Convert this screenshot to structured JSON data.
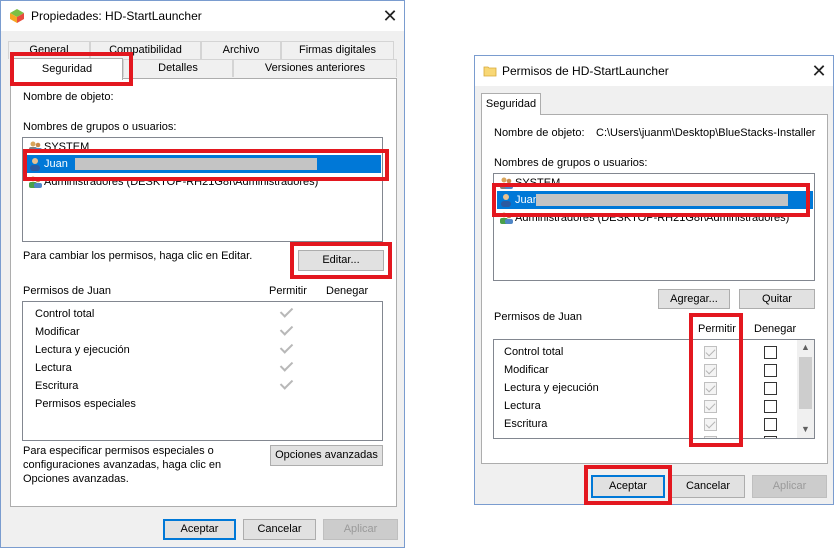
{
  "left_window": {
    "title": "Propiedades: HD-StartLauncher",
    "tabs_row1": [
      "General",
      "Compatibilidad",
      "Archivo",
      "Firmas digitales"
    ],
    "tabs_row2": [
      "Seguridad",
      "Detalles",
      "Versiones anteriores"
    ],
    "object_name_label": "Nombre de objeto:",
    "groups_label": "Nombres de grupos o usuarios:",
    "users": [
      "SYSTEM",
      "Juan",
      "Administradores (DESKTOP-RH21G8I\\Administradores)"
    ],
    "change_text": "Para cambiar los permisos, haga clic en Editar.",
    "edit_button": "Editar...",
    "perm_title": "Permisos de Juan",
    "allow_header": "Permitir",
    "deny_header": "Denegar",
    "permissions": [
      "Control total",
      "Modificar",
      "Lectura y ejecución",
      "Lectura",
      "Escritura",
      "Permisos especiales"
    ],
    "special_text_1": "Para especificar permisos especiales o",
    "special_text_2": "configuraciones avanzadas, haga clic en",
    "special_text_3": "Opciones avanzadas.",
    "advanced_button": "Opciones avanzadas",
    "ok_button": "Aceptar",
    "cancel_button": "Cancelar",
    "apply_button": "Aplicar"
  },
  "right_window": {
    "title": "Permisos de HD-StartLauncher",
    "tab": "Seguridad",
    "object_name_label": "Nombre de objeto:",
    "object_path": "C:\\Users\\juanm\\Desktop\\BlueStacks-Installer",
    "groups_label": "Nombres de grupos o usuarios:",
    "users": [
      "SYSTEM",
      "Juan",
      "Administradores (DESKTOP-RH21G8I\\Administradores)"
    ],
    "add_button": "Agregar...",
    "remove_button": "Quitar",
    "perm_title": "Permisos de Juan",
    "allow_header": "Permitir",
    "deny_header": "Denegar",
    "permissions": [
      "Control total",
      "Modificar",
      "Lectura y ejecución",
      "Lectura",
      "Escritura"
    ],
    "ok_button": "Aceptar",
    "cancel_button": "Cancelar",
    "apply_button": "Aplicar"
  },
  "icons": {
    "app_icon": "bluestacks-icon",
    "folder_icon": "folder-icon",
    "close": "close-icon",
    "user": "user-icon",
    "group": "group-icon"
  },
  "colors": {
    "highlight": "#e3171f",
    "selection": "#0078d7"
  }
}
